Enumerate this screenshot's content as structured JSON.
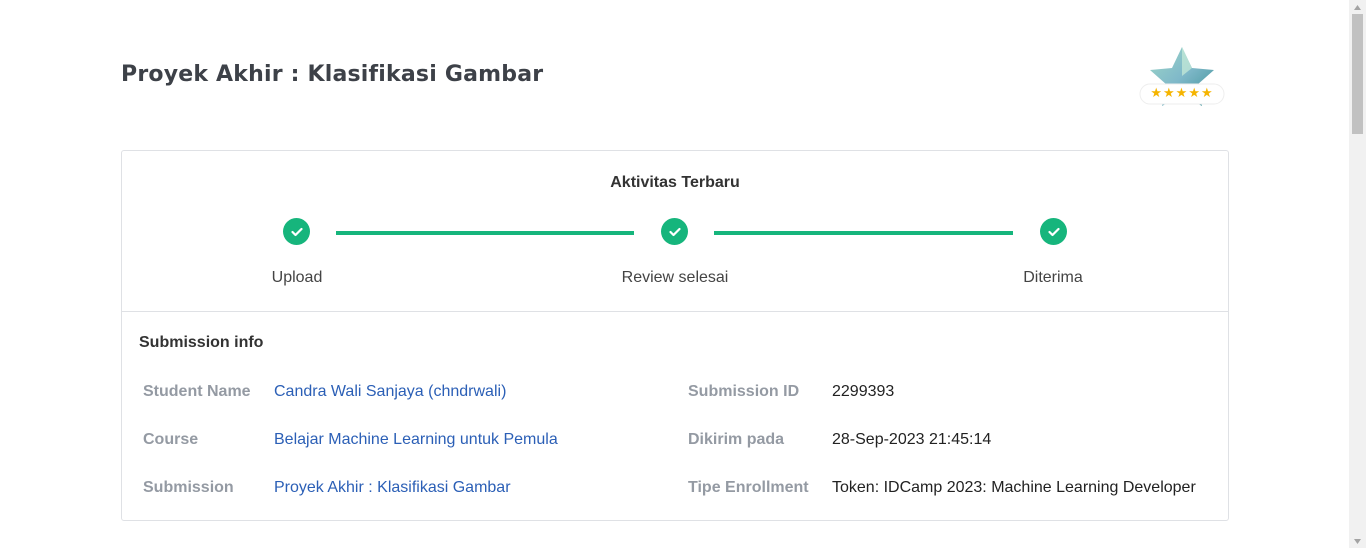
{
  "page": {
    "title": "Proyek Akhir : Klasifikasi Gambar"
  },
  "badge": {
    "icon": "star-rating-badge-icon",
    "stars": 5
  },
  "activity": {
    "title": "Aktivitas Terbaru",
    "accent_color": "#16b57c",
    "steps": [
      {
        "label": "Upload",
        "status": "done"
      },
      {
        "label": "Review selesai",
        "status": "done"
      },
      {
        "label": "Diterima",
        "status": "done"
      }
    ]
  },
  "submission_info": {
    "title": "Submission info",
    "left": [
      {
        "key": "Student Name",
        "value": "Candra Wali Sanjaya (chndrwali)"
      },
      {
        "key": "Course",
        "value": "Belajar Machine Learning untuk Pemula"
      },
      {
        "key": "Submission",
        "value": "Proyek Akhir : Klasifikasi Gambar"
      }
    ],
    "right": [
      {
        "key": "Submission ID",
        "value": "2299393"
      },
      {
        "key": "Dikirim pada",
        "value": "28-Sep-2023 21:45:14"
      },
      {
        "key": "Tipe Enrollment",
        "value": "Token: IDCamp 2023: Machine Learning Developer"
      }
    ]
  }
}
